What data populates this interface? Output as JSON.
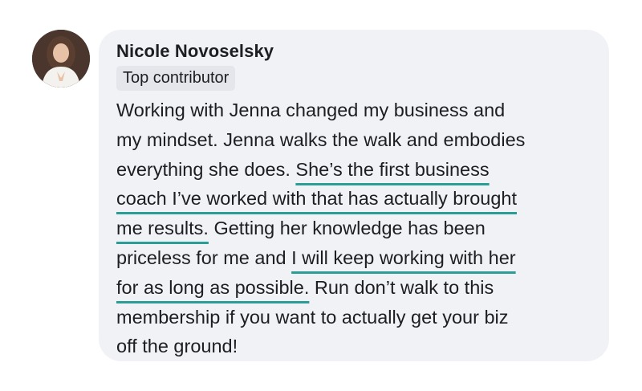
{
  "author": {
    "name": "Nicole Novoselsky",
    "badge": "Top contributor",
    "avatar_icon": "profile-photo"
  },
  "accent_color": "#2a9d96",
  "comment": {
    "segments": [
      {
        "text": "Working with Jenna changed my business and",
        "highlighted": false
      },
      {
        "text": "my mindset. Jenna walks the walk and embodies",
        "highlighted": false
      },
      {
        "text": "everything she does. ",
        "highlighted": false
      },
      {
        "text": "She’s the first business",
        "highlighted": true
      },
      {
        "text": "coach I’ve worked with that has actually brought",
        "highlighted": true
      },
      {
        "text": "me results.",
        "highlighted": true
      },
      {
        "text": " Getting her knowledge has been",
        "highlighted": false
      },
      {
        "text": "priceless for me and ",
        "highlighted": false
      },
      {
        "text": "I will keep working with her",
        "highlighted": true
      },
      {
        "text": "for as long as possible.",
        "highlighted": true
      },
      {
        "text": " Run don’t walk to this",
        "highlighted": false
      },
      {
        "text": "membership if you want to actually get your biz",
        "highlighted": false
      },
      {
        "text": "off the ground!",
        "highlighted": false
      }
    ]
  }
}
